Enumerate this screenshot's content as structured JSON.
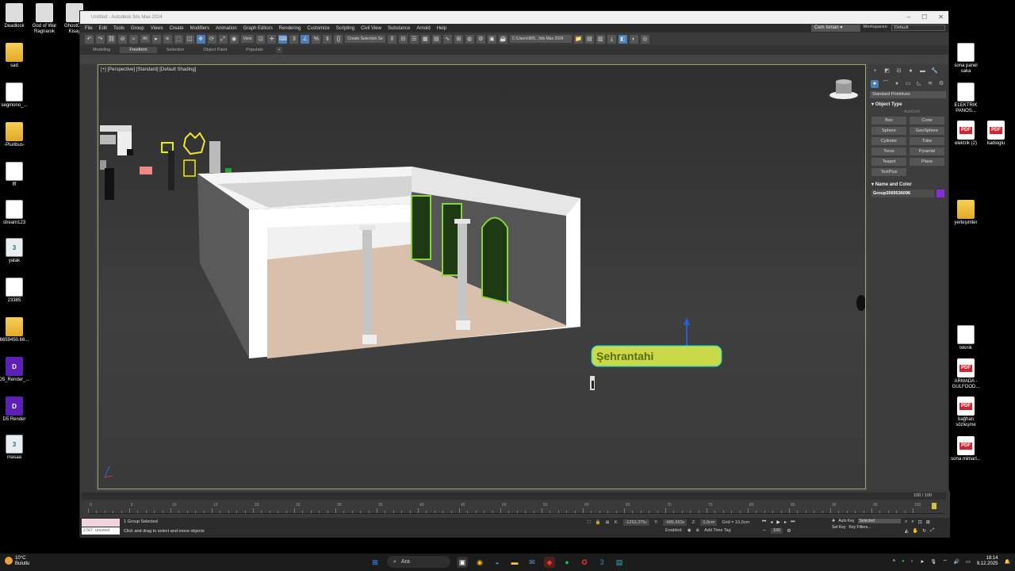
{
  "desktop": {
    "left_icons": [
      {
        "label": "Deadlock",
        "type": "app"
      },
      {
        "label": "God of War Ragnarok",
        "type": "app"
      },
      {
        "label": "GhostOf - Kisay",
        "type": "app"
      },
      {
        "label": "sad",
        "type": "folder"
      },
      {
        "label": "segmono_...",
        "type": "file"
      },
      {
        "label": "-Pluribus-",
        "type": "folder"
      },
      {
        "label": "fff",
        "type": "file"
      },
      {
        "label": "stream123",
        "type": "file"
      },
      {
        "label": "yatak",
        "type": "max"
      },
      {
        "label": "23385",
        "type": "file"
      },
      {
        "label": "6659450.66...",
        "type": "folder"
      },
      {
        "label": "D5_Render_...",
        "type": "d5"
      },
      {
        "label": "D5 Render",
        "type": "d5"
      },
      {
        "label": "masaa",
        "type": "max"
      }
    ],
    "right_icons": [
      {
        "label": "sona panel saka",
        "type": "file"
      },
      {
        "label": "ELEKTRIK PANOS...",
        "type": "file"
      },
      {
        "label": "elektrik (2)",
        "type": "pdf"
      },
      {
        "label": "kadioglu",
        "type": "pdf"
      },
      {
        "label": "yerleşimler",
        "type": "folder"
      },
      {
        "label": "teknik",
        "type": "file"
      },
      {
        "label": "ARMADA - GULFOOD...",
        "type": "pdf"
      },
      {
        "label": "bağhan sözleşme",
        "type": "pdf"
      },
      {
        "label": "sona mimari...",
        "type": "pdf"
      }
    ],
    "pdf_badge": "PDF",
    "max_badge": "3",
    "d5_badge": "D"
  },
  "window": {
    "title": "Untitled - Autodesk 3ds Max 2024",
    "menu": [
      "File",
      "Edit",
      "Tools",
      "Group",
      "Views",
      "Create",
      "Modifiers",
      "Animation",
      "Graph Editors",
      "Rendering",
      "Customize",
      "Scripting",
      "Civil View",
      "Substance",
      "Arnold",
      "Help"
    ],
    "user": "Cem Isman",
    "workspace_label": "Workspaces:",
    "workspace_value": "Default",
    "toolbar_filter": "All",
    "toolbar_view": "View",
    "selection_set": "Create Selection Se",
    "path": "C:\\Users\\905...3ds Max 2024",
    "ribbon_tabs": [
      "Modeling",
      "Freeform",
      "Selection",
      "Object Paint",
      "Populate"
    ],
    "active_ribbon": "Freeform"
  },
  "viewport": {
    "label": "[+] [Perspective] [Standard] [Default Shading]"
  },
  "command_panel": {
    "category": "Standard Primitives",
    "object_type_title": "Object Type",
    "autogrid": "AutoGrid",
    "primitives": [
      "Box",
      "Cone",
      "Sphere",
      "GeoSphere",
      "Cylinder",
      "Tube",
      "Torus",
      "Pyramid",
      "Teapot",
      "Plane",
      "TextPlus"
    ],
    "name_color_title": "Name and Color",
    "object_name": "Group2069536096",
    "object_color": "#8a2be2"
  },
  "timeline": {
    "frame_label": "100 / 100",
    "ticks": [
      "0",
      "5",
      "10",
      "15",
      "20",
      "25",
      "30",
      "35",
      "40",
      "45",
      "50",
      "55",
      "60",
      "65",
      "70",
      "75",
      "80",
      "85",
      "90",
      "95",
      "100"
    ]
  },
  "status": {
    "selected": "1 Group Selected",
    "hint": "Click and drag to select and move objects",
    "memory": "2787 unused",
    "x": "-1263,375c",
    "y": "-685,663c",
    "z": "0,0cm",
    "grid": "Grid = 10,0cm",
    "enabled": "Enabled:",
    "add_time_tag": "Add Time Tag",
    "auto_key": "Auto Key",
    "selected_dropdown": "Selected",
    "set_key": "Set Key",
    "key_filters": "Key Filters...",
    "frame": "100"
  },
  "taskbar": {
    "temp": "10°C",
    "weather": "Bulutlu",
    "search": "Ara",
    "time": "18:14",
    "date": "9.12.2025"
  }
}
